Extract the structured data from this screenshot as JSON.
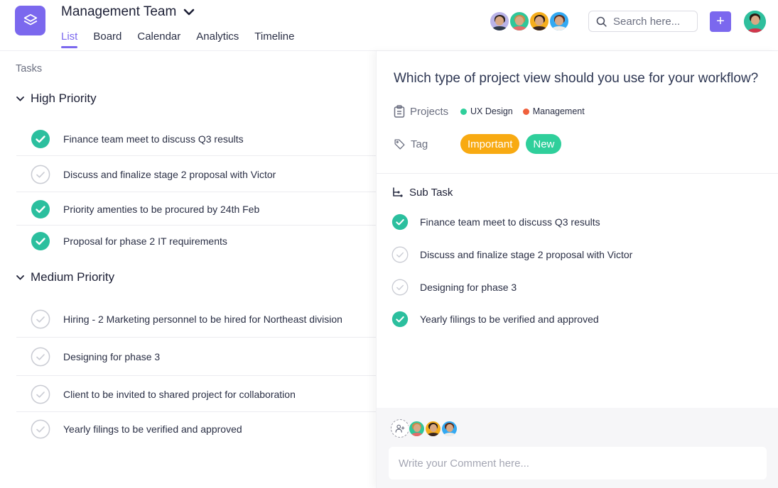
{
  "header": {
    "team_title": "Management Team",
    "tabs": [
      {
        "label": "List",
        "active": true
      },
      {
        "label": "Board",
        "active": false
      },
      {
        "label": "Calendar",
        "active": false
      },
      {
        "label": "Analytics",
        "active": false
      },
      {
        "label": "Timeline",
        "active": false
      }
    ],
    "search_placeholder": "Search here...",
    "add_label": "+",
    "members": [
      {
        "name": "member-1",
        "bg": "#b9b3e8",
        "hair": "#2b2320",
        "shirt": "#2f3a4a"
      },
      {
        "name": "member-2",
        "bg": "#2fc79a",
        "hair": "#c98a4a",
        "shirt": "#e46b6b"
      },
      {
        "name": "member-3",
        "bg": "#f5ad1c",
        "hair": "#2a1b14",
        "shirt": "#3a2620"
      },
      {
        "name": "member-4",
        "bg": "#33a9f2",
        "hair": "#5a2e20",
        "shirt": "#f1ede8"
      }
    ],
    "user": {
      "bg": "#2fbf9d",
      "hair": "#2a1b14",
      "shirt": "#d2354b"
    }
  },
  "tasks": {
    "label": "Tasks",
    "groups": [
      {
        "title": "High Priority",
        "items": [
          {
            "text": "Finance team meet to discuss Q3 results",
            "done": true
          },
          {
            "text": "Discuss and finalize stage 2 proposal with Victor",
            "done": false
          },
          {
            "text": "Priority amenties to be procured by 24th Feb",
            "done": true
          },
          {
            "text": "Proposal for phase 2 IT requirements",
            "done": true
          }
        ]
      },
      {
        "title": "Medium Priority",
        "items": [
          {
            "text": "Hiring - 2 Marketing personnel to be hired for Northeast division",
            "done": false
          },
          {
            "text": "Designing for phase 3",
            "done": false
          },
          {
            "text": "Client to be invited to shared project for collaboration",
            "done": false
          },
          {
            "text": "Yearly filings to be verified and approved",
            "done": false
          }
        ]
      }
    ]
  },
  "detail": {
    "title": "Which type of project view should you use for your workflow?",
    "projects_label": "Projects",
    "projects": [
      {
        "label": "UX Design",
        "color": "#2fcf9b"
      },
      {
        "label": "Management",
        "color": "#f0603c"
      }
    ],
    "tag_label": "Tag",
    "tags": [
      {
        "label": "Important",
        "color": "#f8aa12"
      },
      {
        "label": "New",
        "color": "#2fcf9b"
      }
    ],
    "subtask_label": "Sub Task",
    "subtasks": [
      {
        "text": "Finance team meet to discuss Q3 results",
        "done": true
      },
      {
        "text": "Discuss and finalize stage 2 proposal with Victor",
        "done": false
      },
      {
        "text": "Designing for phase 3",
        "done": false
      },
      {
        "text": "Yearly filings to be verified and approved",
        "done": true
      }
    ],
    "comment_placeholder": "Write your Comment here...",
    "participants": [
      {
        "bg": "#2fc79a",
        "hair": "#c98a4a",
        "shirt": "#e46b6b"
      },
      {
        "bg": "#f5ad1c",
        "hair": "#2a1b14",
        "shirt": "#3a2620"
      },
      {
        "bg": "#33a9f2",
        "hair": "#5a2e20",
        "shirt": "#f1ede8"
      }
    ]
  },
  "colors": {
    "accent": "#7b68ee",
    "done": "#2bbf9e",
    "pending": "#c9cbd3"
  }
}
